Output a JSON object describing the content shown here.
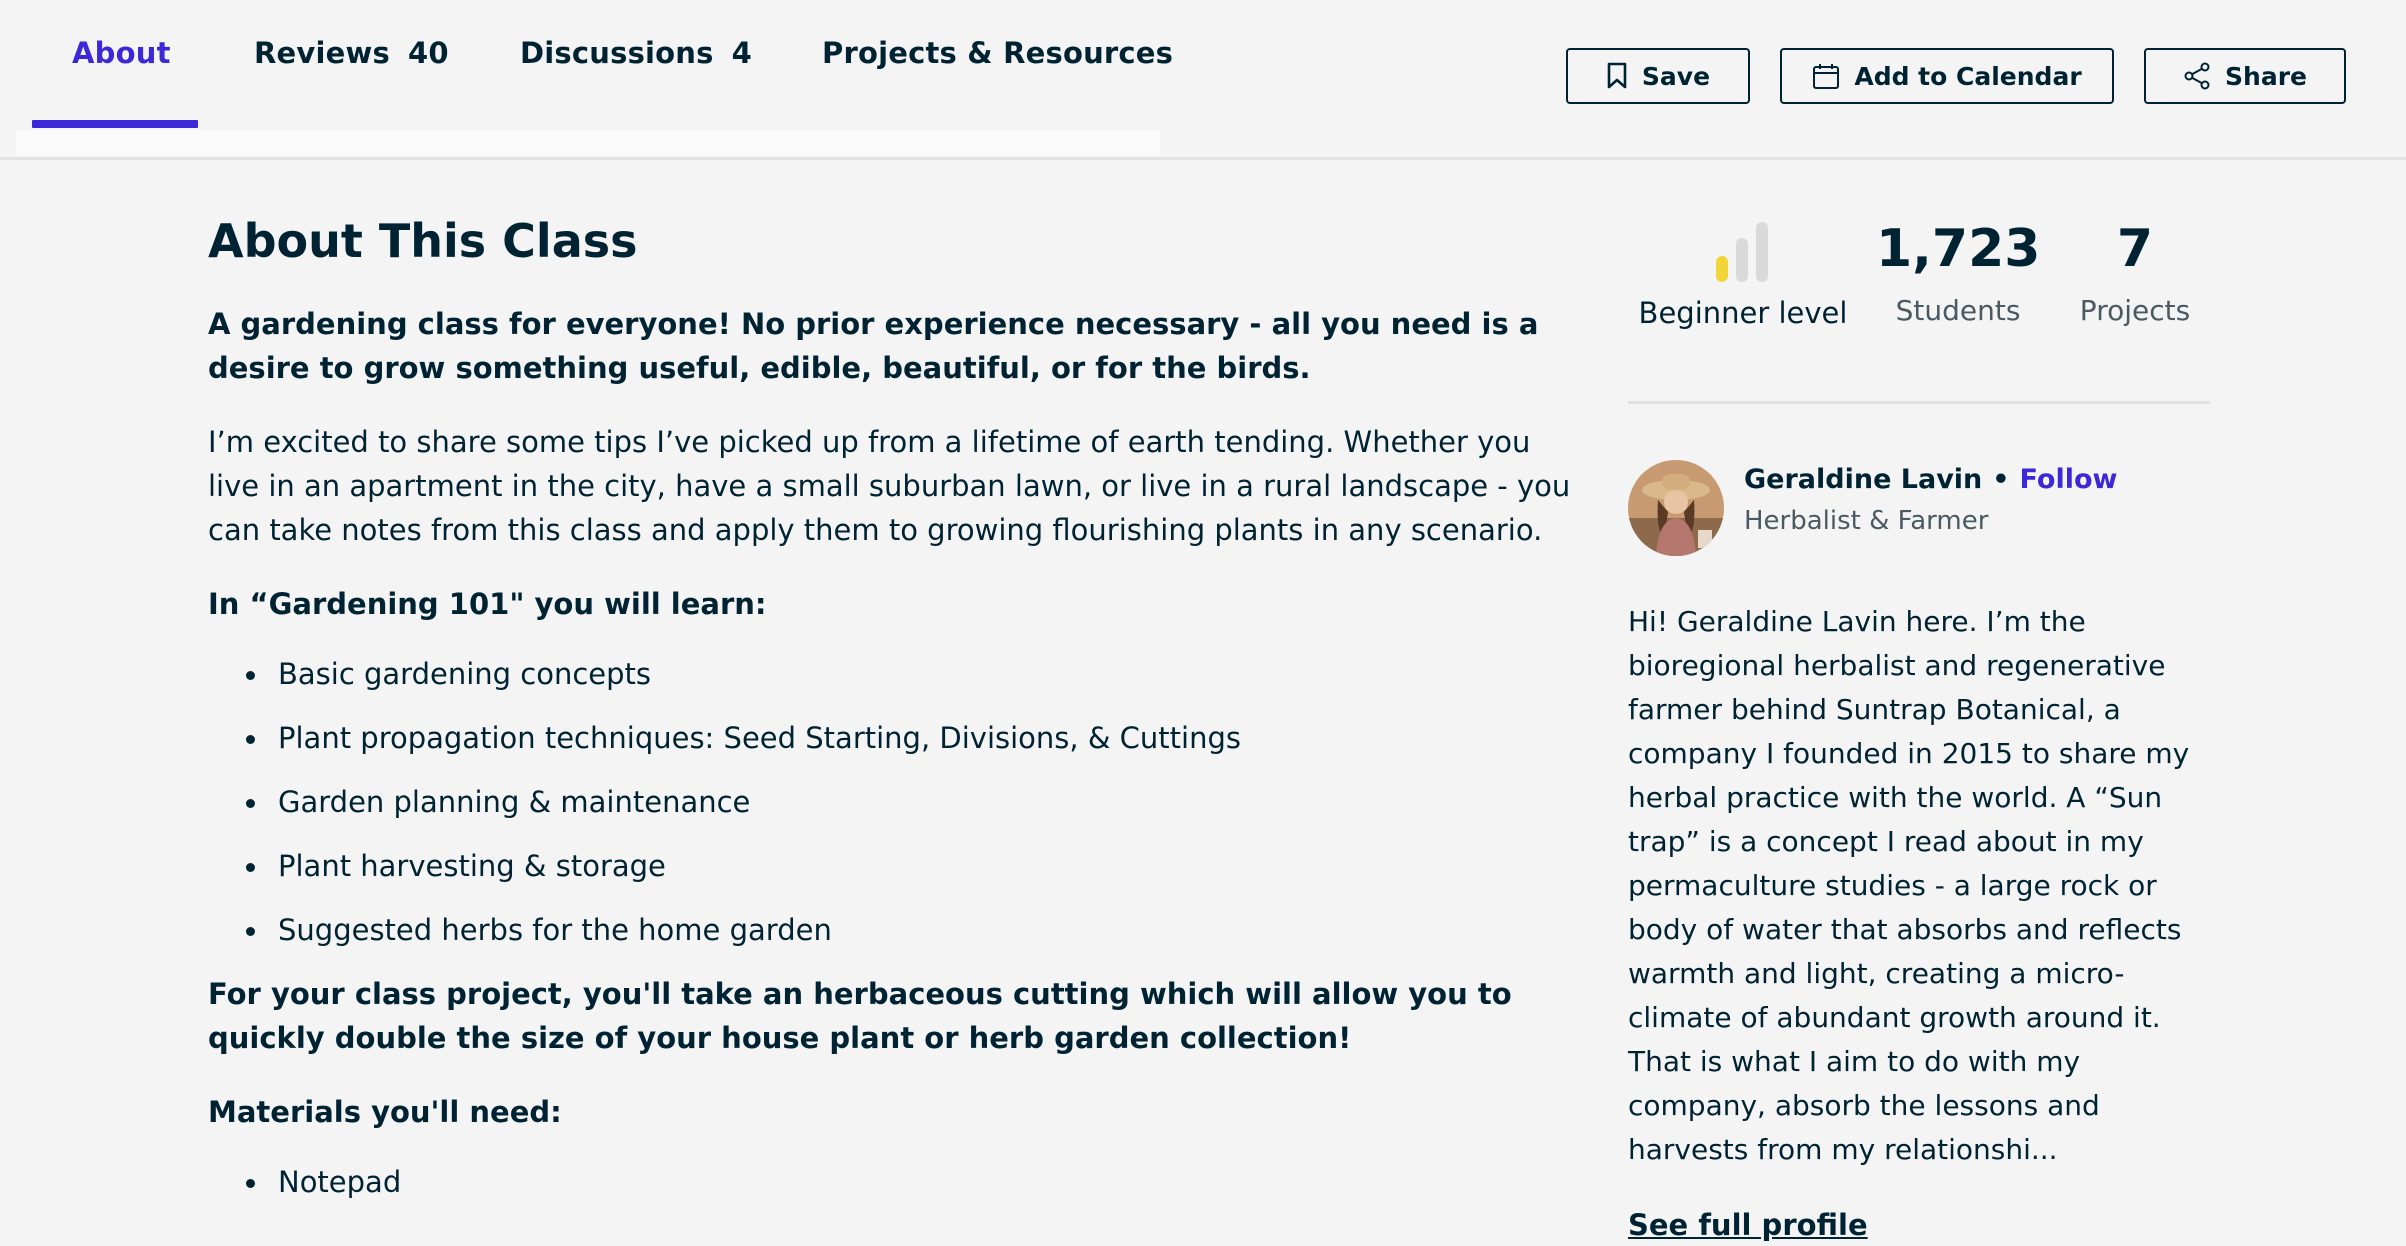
{
  "tabs": [
    {
      "label": "About",
      "count": ""
    },
    {
      "label": "Reviews",
      "count": "40"
    },
    {
      "label": "Discussions",
      "count": "4"
    },
    {
      "label": "Projects & Resources",
      "count": ""
    }
  ],
  "actions": {
    "save": "Save",
    "calendar": "Add to Calendar",
    "share": "Share"
  },
  "about": {
    "title": "About This Class",
    "intro": "A gardening class for everyone! No prior experience necessary - all you need is a desire to grow something useful, edible, beautiful, or for the birds.",
    "body": "I’m excited to share some tips I’ve picked up from a lifetime of earth tending. Whether you live in an apartment in the city, have a small suburban lawn, or live in a rural landscape - you can take notes from this class and apply them to growing flourishing plants in any scenario.",
    "learn_heading": "In “Gardening 101\" you will learn:",
    "learn_items": [
      "Basic gardening concepts",
      "Plant propagation techniques: Seed Starting, Divisions, & Cuttings",
      "Garden planning & maintenance",
      "Plant harvesting & storage",
      "Suggested herbs for the home garden"
    ],
    "project": "For your class project, you'll take an herbaceous cutting which will allow you to quickly double the size of your house plant or herb garden collection!",
    "materials_heading": "Materials you'll need:",
    "materials_items": [
      "Notepad"
    ]
  },
  "stats": {
    "level": "Beginner level",
    "level_fraction": 0.33,
    "students_value": "1,723",
    "students_label": "Students",
    "projects_value": "7",
    "projects_label": "Projects"
  },
  "teacher": {
    "name": "Geraldine Lavin",
    "dot": "•",
    "follow": "Follow",
    "title": "Herbalist & Farmer",
    "bio": "Hi! Geraldine Lavin here. I’m the bioregional herbalist and regenerative farmer behind Suntrap Botanical, a company I founded in 2015 to share my herbal practice with the world. A “Sun trap” is a concept I read about in my permaculture studies - a large rock or body of water that absorbs and reflects warmth and light, creating a micro-climate of abundant growth around it. That is what I aim to do with my company, absorb the lessons and harvests from my relationshi...",
    "see_profile": "See full profile"
  },
  "colors": {
    "accent": "#3d28d9",
    "text": "#002333",
    "level_active": "#f2d638",
    "level_inactive": "#d9d9d9"
  }
}
